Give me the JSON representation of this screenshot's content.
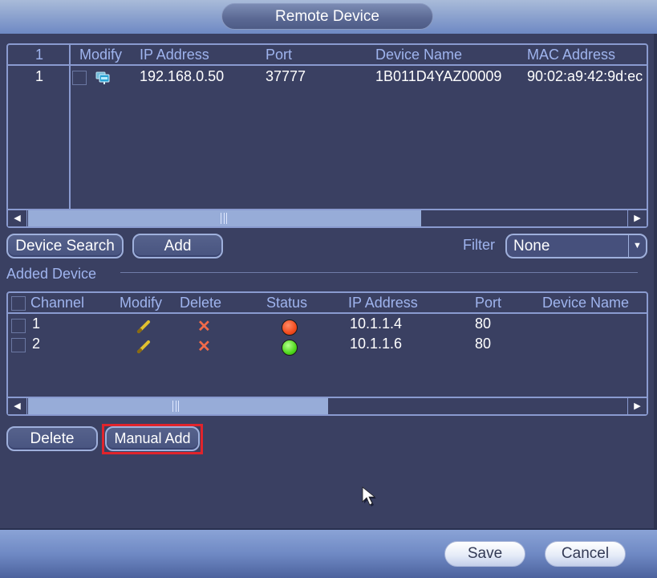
{
  "window": {
    "title": "Remote Device"
  },
  "search_table": {
    "columns": [
      "1",
      "Modify",
      "IP Address",
      "Port",
      "Device Name",
      "MAC Address"
    ],
    "rows": [
      {
        "index": "1",
        "checked": false,
        "icon": "monitor-icon",
        "ip": "192.168.0.50",
        "port": "37777",
        "device_name": "1B011D4YAZ00009",
        "mac": "90:02:a9:42:9d:ec"
      }
    ],
    "scroll_position": 0.0,
    "scroll_visible_fraction": 0.62
  },
  "actions": {
    "device_search_label": "Device Search",
    "add_label": "Add",
    "filter_label": "Filter",
    "filter_value": "None"
  },
  "added_section": {
    "title": "Added Device"
  },
  "added_table": {
    "columns": [
      "Channel",
      "Modify",
      "Delete",
      "Status",
      "IP Address",
      "Port",
      "Device Name"
    ],
    "rows": [
      {
        "channel": "1",
        "checked": false,
        "status": "offline",
        "status_color": "#f24b1e",
        "ip": "10.1.1.4",
        "port": "80",
        "device_name": ""
      },
      {
        "channel": "2",
        "checked": false,
        "status": "online",
        "status_color": "#4fd81c",
        "ip": "10.1.1.6",
        "port": "80",
        "device_name": ""
      }
    ],
    "scroll_position": 0.0,
    "scroll_visible_fraction": 0.5
  },
  "bottom_actions": {
    "delete_label": "Delete",
    "manual_add_label": "Manual Add",
    "highlighted": "Manual Add"
  },
  "footer": {
    "save_label": "Save",
    "cancel_label": "Cancel"
  },
  "colors": {
    "background": "#3a4062",
    "header_text": "#9fb4ee",
    "border": "#8a9bd0",
    "highlight": "#e0242c"
  }
}
